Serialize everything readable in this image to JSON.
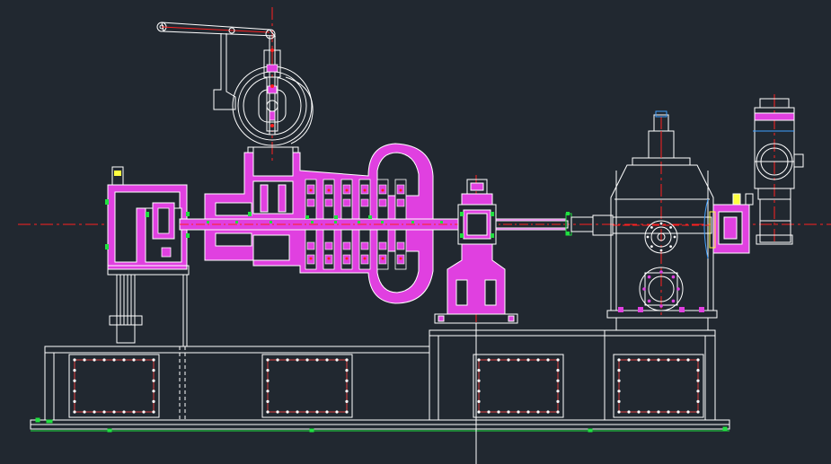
{
  "drawing": {
    "background": "#212830",
    "colors": {
      "outline": "#ffffff",
      "section_fill": "#e040e0",
      "centerline": "#ff2020",
      "dimension": "#20e040",
      "highlight": "#ffff40",
      "accent_blue": "#40a0ff"
    },
    "components": [
      "lever-linkage",
      "handwheel-valve",
      "coupling-housing",
      "turbine-casing",
      "rotor-shaft",
      "bearing-pedestal",
      "gearbox",
      "electric-motor",
      "base-frame",
      "support-legs"
    ]
  }
}
